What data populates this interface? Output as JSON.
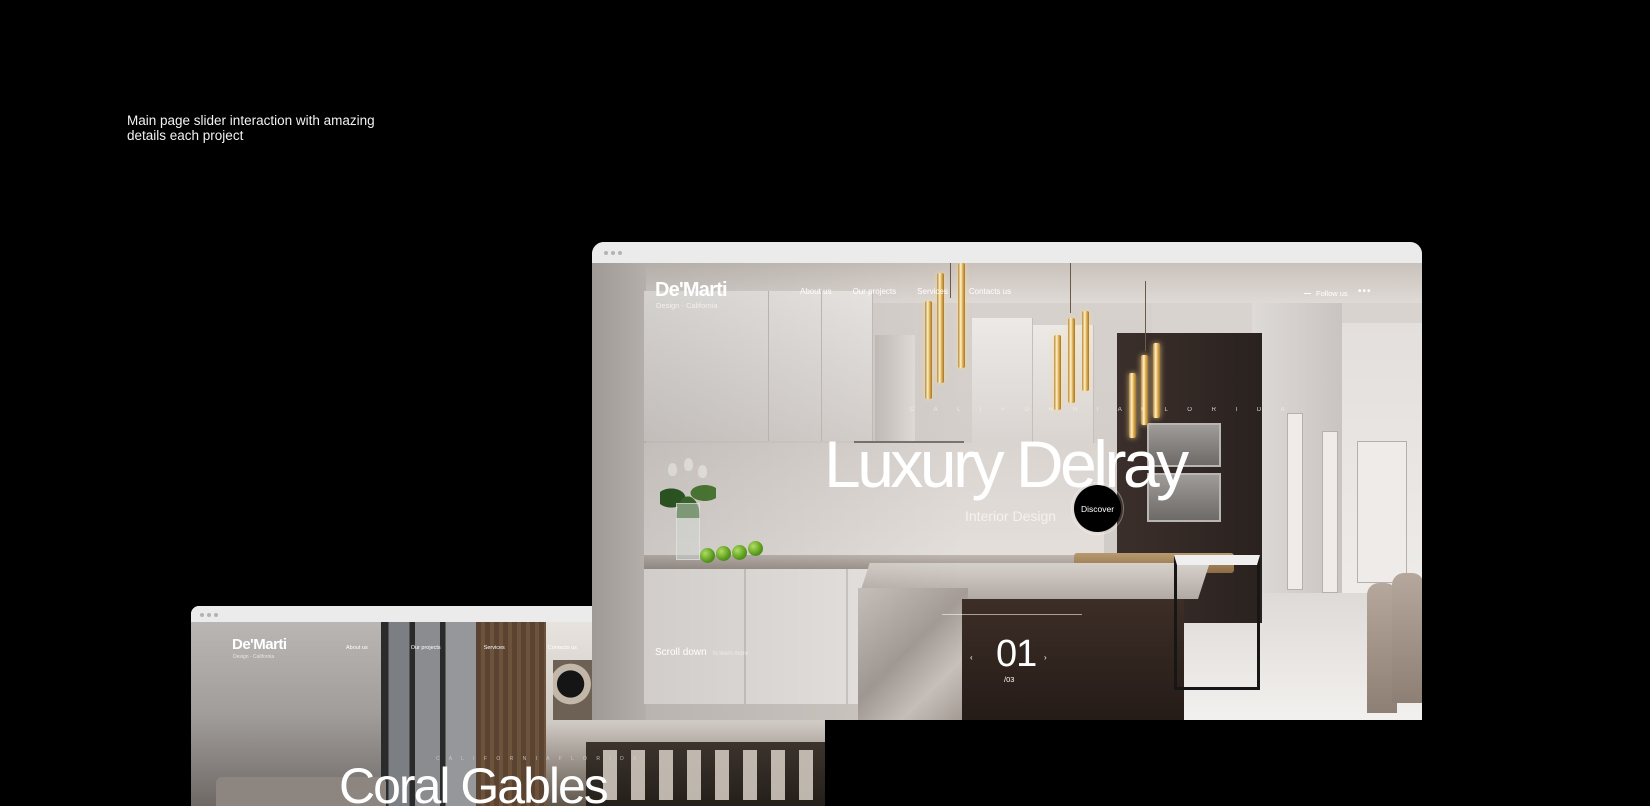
{
  "caption": "Main page slider interaction with amazing details each project",
  "front": {
    "logo": "De'Marti",
    "logo_sub": "Design  -  California",
    "nav": [
      "About us",
      "Our projects",
      "Services",
      "Contacts us"
    ],
    "follow": "Follow us",
    "more": "•••",
    "kicker": "C A L I F O R N I A     F L O R I D A",
    "title": "Luxury Delray",
    "subtitle": "Interior Design",
    "discover": "Discover",
    "scroll": "Scroll down",
    "scroll_hint": "to learn more",
    "slide_current": "01",
    "slide_total": "/03",
    "prev_arrow": "‹",
    "next_arrow": "›"
  },
  "back": {
    "logo": "De'Marti",
    "logo_sub": "Design  -  California",
    "nav": [
      "About us",
      "Our projects",
      "Services",
      "Contacts us"
    ],
    "kicker": "C A L I F O R N I A     F L O R I D A",
    "title": "Coral Gables"
  },
  "colors": {
    "background": "#000000",
    "text": "#ffffff",
    "chrome": "#ebebeb"
  }
}
